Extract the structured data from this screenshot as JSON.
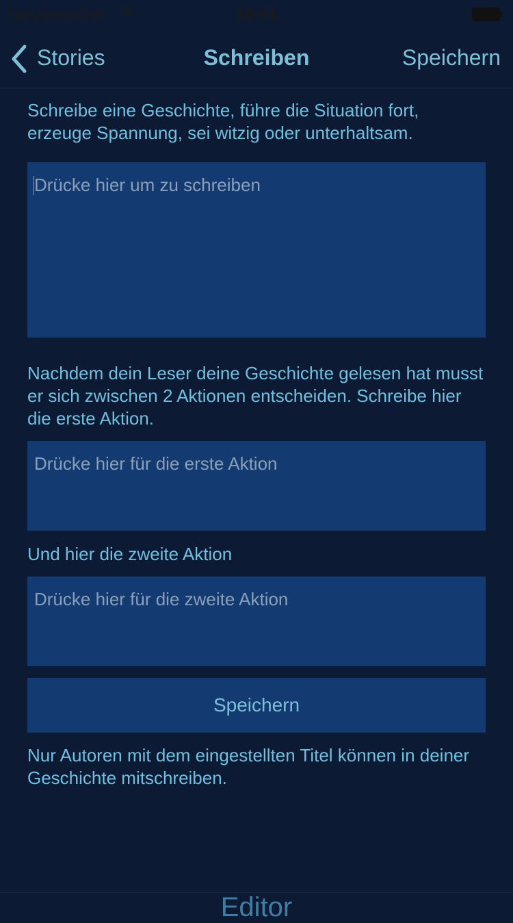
{
  "status_bar": {
    "carrier": "Netzbetreiber",
    "time": "18:51"
  },
  "nav": {
    "back_label": "Stories",
    "title": "Schreiben",
    "save_label": "Speichern"
  },
  "intro_text": "Schreibe eine Geschichte, führe die Situation fort, erzeuge Spannung, sei witzig oder unterhaltsam.",
  "story_field": {
    "placeholder": "Drücke hier um zu schreiben"
  },
  "actions_text": "Nachdem dein Leser deine Geschichte gelesen hat musst er sich zwischen 2 Aktionen entscheiden. Schreibe hier die erste Aktion.",
  "action1_field": {
    "placeholder": "Drücke hier für die erste Aktion"
  },
  "action2_label": "Und hier die zweite Aktion",
  "action2_field": {
    "placeholder": "Drücke hier für die zweite Aktion"
  },
  "save_button": "Speichern",
  "footer_note": "Nur Autoren mit dem eingestellten Titel können in deiner Geschichte mitschreiben.",
  "tab_bar": {
    "label": "Editor"
  },
  "colors": {
    "background": "#0c1b33",
    "field": "#143b71",
    "accent": "#7cc0d8"
  }
}
